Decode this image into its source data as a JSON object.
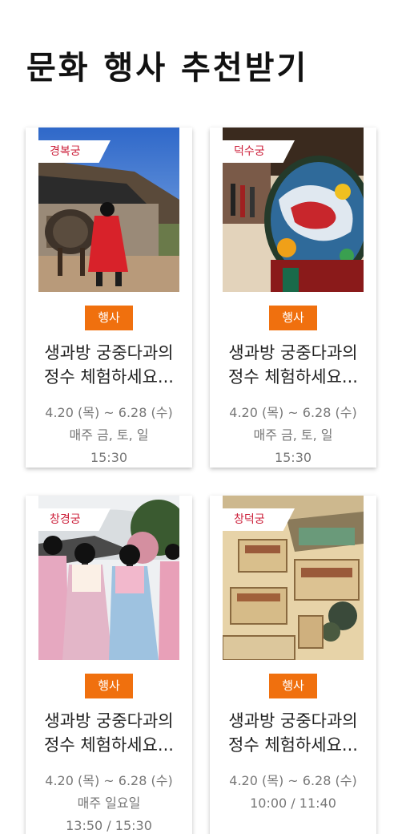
{
  "page": {
    "title": "문화 행사 추천받기"
  },
  "cards": [
    {
      "place": "경복궁",
      "tag": "행사",
      "title_line1": "생과방 궁중다과의",
      "title_line2": "정수 체험하세요...",
      "date": "4.20 (목) ~ 6.28 (수)",
      "days": "매주 금, 토, 일",
      "times": "15:30",
      "image": "guard-with-drum-photo"
    },
    {
      "place": "덕수궁",
      "tag": "행사",
      "title_line1": "생과방 궁중다과의",
      "title_line2": "정수 체험하세요...",
      "date": "4.20 (목) ~ 6.28 (수)",
      "days": "매주 금, 토, 일",
      "times": "15:30",
      "image": "dragon-painted-drum-photo"
    },
    {
      "place": "창경궁",
      "tag": "행사",
      "title_line1": "생과방 궁중다과의",
      "title_line2": "정수 체험하세요...",
      "date": "4.20 (목) ~ 6.28 (수)",
      "days": "매주 일요일",
      "times": "13:50 / 15:30",
      "image": "hanbok-girls-photo"
    },
    {
      "place": "창덕궁",
      "tag": "행사",
      "title_line1": "생과방 궁중다과의",
      "title_line2": "정수 체험하세요...",
      "date": "4.20 (목) ~ 6.28 (수)",
      "days": "10:00 / 11:40",
      "times": "",
      "image": "palace-painting-photo"
    }
  ],
  "colors": {
    "accent": "#f0700e",
    "place_label": "#cc1f3a"
  }
}
